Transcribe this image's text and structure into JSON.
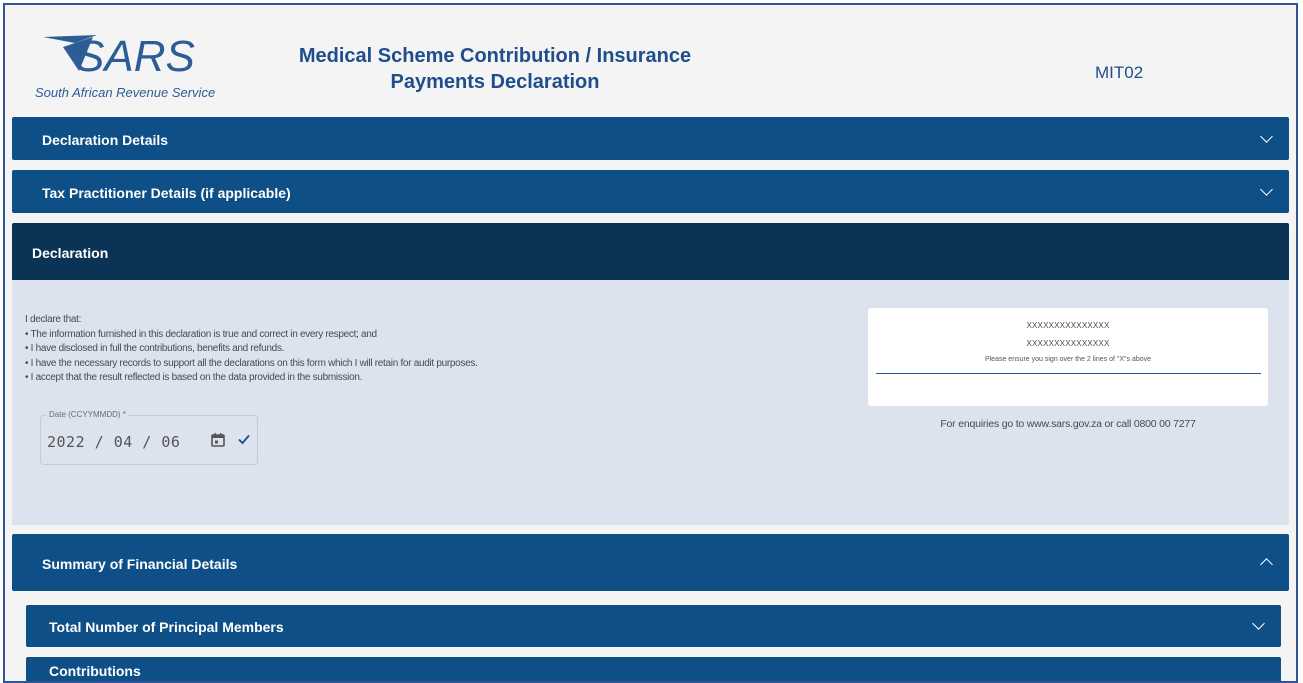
{
  "header": {
    "logo_text": "SARS",
    "logo_tagline": "South African Revenue Service",
    "title_line1": "Medical Scheme Contribution / Insurance",
    "title_line2": "Payments Declaration",
    "form_code": "MIT02"
  },
  "sections": {
    "declaration_details": "Declaration Details",
    "tax_practitioner": "Tax Practitioner Details (if applicable)",
    "declaration": "Declaration",
    "summary": "Summary of Financial Details",
    "principal_members": "Total Number of Principal Members",
    "contributions": "Contributions"
  },
  "declaration": {
    "intro": "I declare that:",
    "items": [
      "• The information furnished in this declaration is true and correct in every respect; and",
      "• I have disclosed in full the contributions, benefits and refunds.",
      "• I have the necessary records to support all the declarations on this form which I will retain for audit purposes.",
      "• I accept that the result reflected is based on the data provided in the submission."
    ],
    "date_label": "Date (CCYYMMDD) *",
    "date_value": "2022 / 04 / 06",
    "signature": {
      "line1": "XXXXXXXXXXXXXXX",
      "line2": "XXXXXXXXXXXXXXX",
      "note": "Please ensure you sign over the 2 lines of \"X\"s above"
    },
    "enquiry": "For enquiries go to www.sars.gov.za or call 0800 00 7277"
  },
  "colors": {
    "bar": "#0d4f86",
    "bar_active": "#0a3355",
    "panel": "#dce3ee",
    "title": "#1f4e8c"
  }
}
